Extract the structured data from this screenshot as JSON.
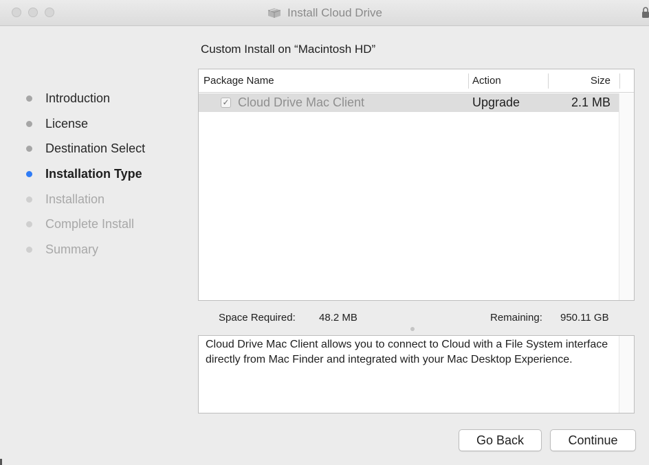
{
  "window": {
    "title": "Install Cloud Drive",
    "app_icon": "installer-box-icon",
    "lock_icon": "lock-icon"
  },
  "sidebar": {
    "steps": [
      {
        "label": "Introduction",
        "state": "done"
      },
      {
        "label": "License",
        "state": "done"
      },
      {
        "label": "Destination Select",
        "state": "done"
      },
      {
        "label": "Installation Type",
        "state": "current"
      },
      {
        "label": "Installation",
        "state": "todo"
      },
      {
        "label": "Complete Install",
        "state": "todo"
      },
      {
        "label": "Summary",
        "state": "todo"
      }
    ]
  },
  "main": {
    "heading": "Custom Install on “Macintosh HD”",
    "table": {
      "columns": [
        "Package Name",
        "Action",
        "Size"
      ],
      "rows": [
        {
          "checked": true,
          "name": "Cloud Drive Mac Client",
          "action": "Upgrade",
          "size": "2.1 MB"
        }
      ]
    },
    "space": {
      "required_label": "Space Required:",
      "required_value": "48.2 MB",
      "remaining_label": "Remaining:",
      "remaining_value": "950.11 GB"
    },
    "description": "Cloud Drive Mac Client allows you to connect to Cloud with a File System interface directly from Mac Finder and integrated with your Mac Desktop Experience."
  },
  "buttons": {
    "back": "Go Back",
    "continue": "Continue"
  },
  "colors": {
    "accent": "#2f7cf6",
    "window_bg": "#ececec"
  }
}
